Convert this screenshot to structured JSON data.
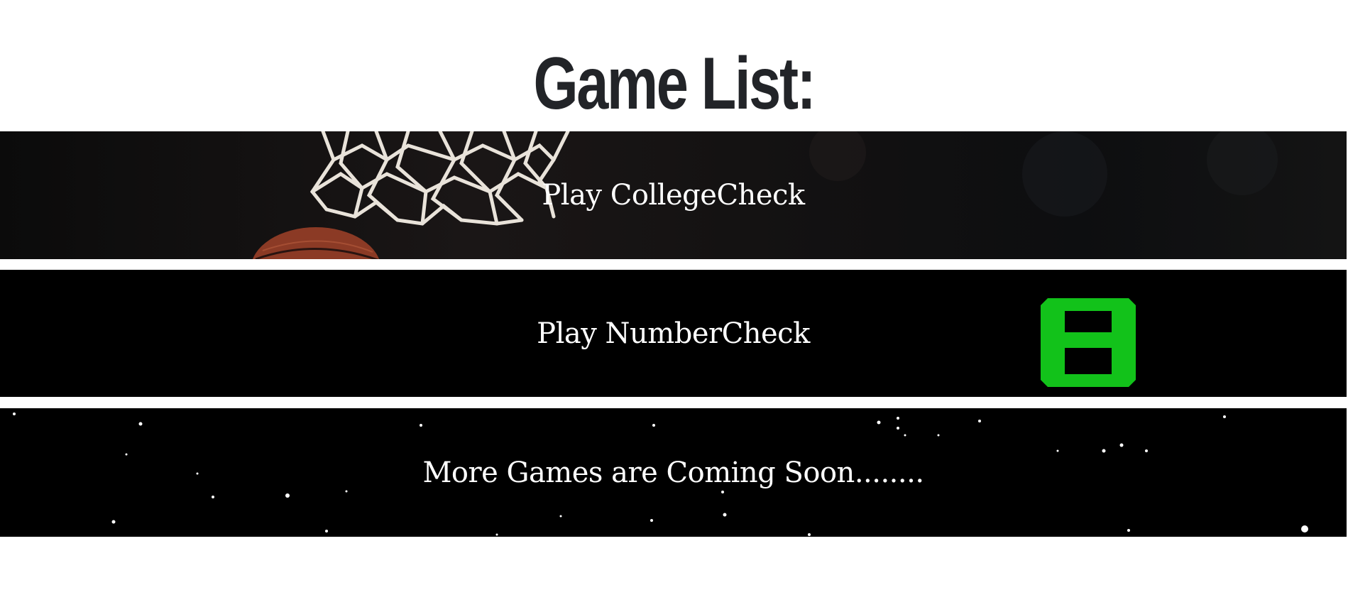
{
  "page": {
    "title": "Game List:"
  },
  "games": [
    {
      "label": "Play CollegeCheck",
      "image": "basketball-hoop-net"
    },
    {
      "label": "Play NumberCheck",
      "image": "green-digit-eight"
    },
    {
      "label": "More Games are Coming Soon........",
      "image": "starfield"
    }
  ],
  "colors": {
    "title": "#222428",
    "banner_text": "#ffffff",
    "banner_bg": "#000000",
    "digit_green": "#12c21a"
  }
}
